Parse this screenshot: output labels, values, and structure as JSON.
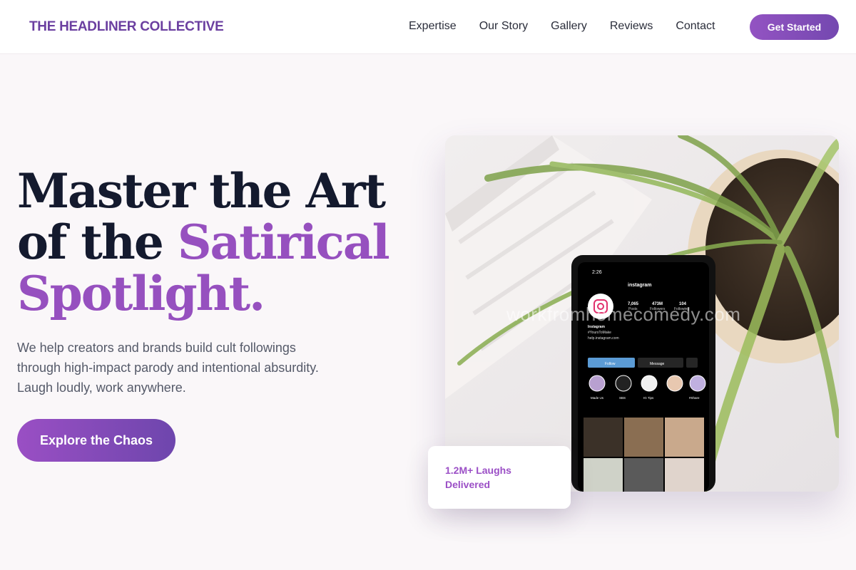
{
  "brand": {
    "name": "THE HEADLINER COLLECTIVE",
    "accent_color": "#9650bf"
  },
  "nav": {
    "items": [
      {
        "label": "Expertise"
      },
      {
        "label": "Our Story"
      },
      {
        "label": "Gallery"
      },
      {
        "label": "Reviews"
      },
      {
        "label": "Contact"
      }
    ],
    "cta_label": "Get Started"
  },
  "hero": {
    "headline_line1": "Master the Art",
    "headline_line2_plain": "of the ",
    "headline_line2_accent": "Satirical",
    "headline_line3_accent": "Spotlight.",
    "subtitle": "We help creators and brands build cult followings through high-impact parody and intentional absurdity. Laugh loudly, work anywhere.",
    "cta_label": "Explore the Chaos"
  },
  "image": {
    "watermark": "workfromhomecomedy.com",
    "phone": {
      "time": "2:26",
      "app_title": "instagram",
      "stats": [
        {
          "value": "7,065",
          "label": "Posts"
        },
        {
          "value": "473M",
          "label": "Followers"
        },
        {
          "value": "104",
          "label": "Following"
        }
      ],
      "profile_name": "Instagram",
      "profile_tag": "#YoursToMake",
      "profile_link": "help.instagram.com",
      "follow_label": "Follow",
      "message_label": "Message",
      "highlights": [
        "Made Us",
        "SBS",
        "IG Tips",
        "",
        "#Share"
      ]
    }
  },
  "stat_card": {
    "text": "1.2M+ Laughs Delivered"
  }
}
